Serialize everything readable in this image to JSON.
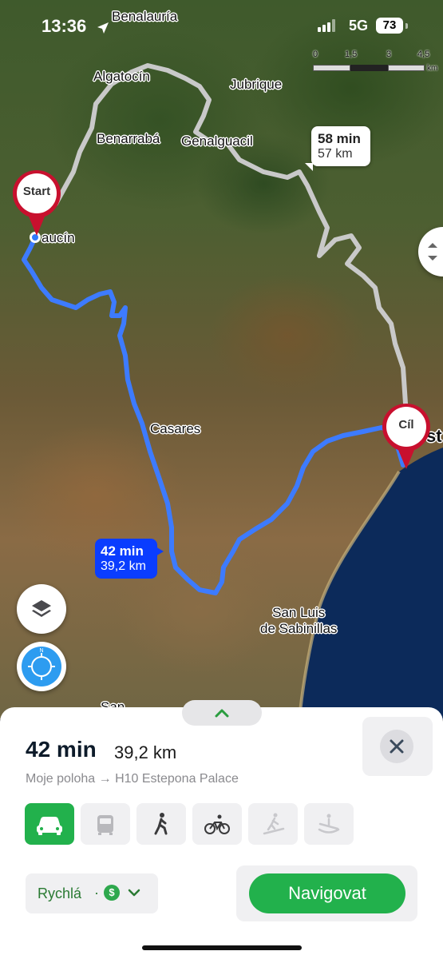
{
  "status_bar": {
    "time": "13:36",
    "network": "5G",
    "battery": "73"
  },
  "map": {
    "scale_labels": [
      "0",
      "1,5",
      "3",
      "4,5"
    ],
    "scale_unit": "km",
    "places": {
      "benalauria": "Benalauría",
      "algatocin": "Algatocín",
      "jubrique": "Jubrique",
      "benarraba": "Benarrabá",
      "genalguacil": "Genalguacil",
      "gaucin": "aucín",
      "casares": "Casares",
      "san_luis_line1": "San Luis",
      "san_luis_line2": "de Sabinillas",
      "cut_label_right": "st",
      "cut_label_bottom": "San"
    },
    "alt_route": {
      "time": "58 min",
      "distance": "57 km"
    },
    "main_route": {
      "time": "42 min",
      "distance": "39,2 km"
    },
    "start_pin": "Start",
    "end_pin": "Cíl",
    "colors": {
      "route": "#3d7bff",
      "alt_route": "#c9c9c9",
      "pin": "#c8102e",
      "sea": "#0c2a5a"
    }
  },
  "sheet": {
    "duration": "42 min",
    "distance": "39,2 km",
    "route_description": "Moje poloha → H10 Estepona Palace",
    "modes": [
      {
        "name": "car",
        "active": true
      },
      {
        "name": "bus",
        "active": false
      },
      {
        "name": "walk",
        "active": false
      },
      {
        "name": "bike",
        "active": false
      },
      {
        "name": "ski",
        "active": false
      },
      {
        "name": "boat",
        "active": false
      }
    ],
    "route_type": "Rychlá",
    "toll_icon": "$",
    "navigate_label": "Navigovat",
    "accent": "#22b14c"
  }
}
